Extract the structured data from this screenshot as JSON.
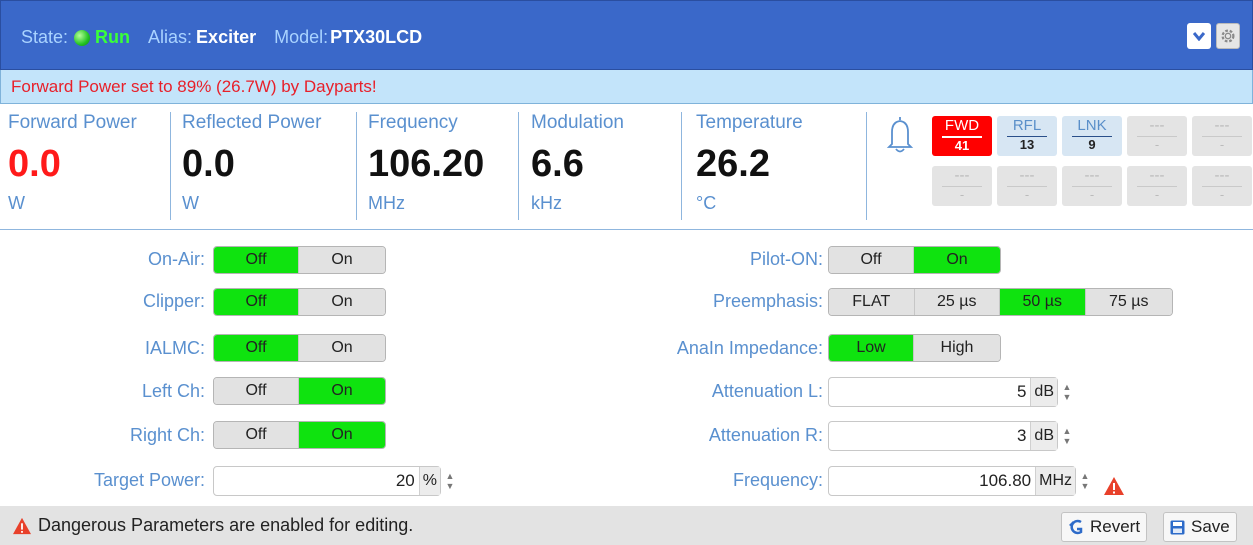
{
  "header": {
    "state_label": "State:",
    "state_value": "Run",
    "alias_label": "Alias:",
    "alias_value": "Exciter",
    "model_label": "Model:",
    "model_value": "PTX30LCD",
    "icons": [
      "status-led-icon",
      "chevron-down-icon",
      "gear-icon"
    ]
  },
  "banner": {
    "text": "Forward Power set to 89% (26.7W) by Dayparts!"
  },
  "meters": [
    {
      "label": "Forward Power",
      "value": "0.0",
      "unit": "W"
    },
    {
      "label": "Reflected Power",
      "value": "0.0",
      "unit": "W"
    },
    {
      "label": "Frequency",
      "value": "106.20",
      "unit": "MHz"
    },
    {
      "label": "Modulation",
      "value": "6.6",
      "unit": "kHz"
    },
    {
      "label": "Temperature",
      "value": "26.2",
      "unit": "°C"
    }
  ],
  "alarm_tiles": [
    {
      "top": "FWD",
      "bottom": "41"
    },
    {
      "top": "RFL",
      "bottom": "13"
    },
    {
      "top": "LNK",
      "bottom": "9"
    },
    {
      "top": "---",
      "bottom": "-"
    },
    {
      "top": "---",
      "bottom": "-"
    },
    {
      "top": "---",
      "bottom": "-"
    },
    {
      "top": "---",
      "bottom": "-"
    },
    {
      "top": "---",
      "bottom": "-"
    },
    {
      "top": "---",
      "bottom": "-"
    },
    {
      "top": "---",
      "bottom": "-"
    }
  ],
  "left_controls": {
    "on_air": {
      "label": "On-Air:",
      "off": "Off",
      "on": "On",
      "selected": "Off"
    },
    "clipper": {
      "label": "Clipper:",
      "off": "Off",
      "on": "On",
      "selected": "Off"
    },
    "ialmc": {
      "label": "IALMC:",
      "off": "Off",
      "on": "On",
      "selected": "Off"
    },
    "left_ch": {
      "label": "Left Ch:",
      "off": "Off",
      "on": "On",
      "selected": "On"
    },
    "right_ch": {
      "label": "Right Ch:",
      "off": "Off",
      "on": "On",
      "selected": "On"
    },
    "target_power": {
      "label": "Target Power:",
      "value": "20",
      "unit": "%"
    }
  },
  "right_controls": {
    "pilot_on": {
      "label": "Pilot-ON:",
      "off": "Off",
      "on": "On",
      "selected": "On"
    },
    "preemphasis": {
      "label": "Preemphasis:",
      "options": [
        "FLAT",
        "25 µs",
        "50 µs",
        "75 µs"
      ],
      "selected": "50 µs"
    },
    "anain_impedance": {
      "label": "AnaIn Impedance:",
      "low": "Low",
      "high": "High",
      "selected": "Low"
    },
    "attenuation_l": {
      "label": "Attenuation L:",
      "value": "5",
      "unit": "dB"
    },
    "attenuation_r": {
      "label": "Attenuation R:",
      "value": "3",
      "unit": "dB"
    },
    "frequency": {
      "label": "Frequency:",
      "value": "106.80",
      "unit": "MHz"
    }
  },
  "footer": {
    "message": "Dangerous Parameters are enabled for editing.",
    "revert_label": "Revert",
    "save_label": "Save"
  },
  "colors": {
    "header_bg": "#3a68c9",
    "banner_bg": "#c3e4fa",
    "banner_text": "#e8202a",
    "active_green": "#0fe30f",
    "label_blue": "#5a90cf",
    "alarm_red": "#ff0000"
  }
}
